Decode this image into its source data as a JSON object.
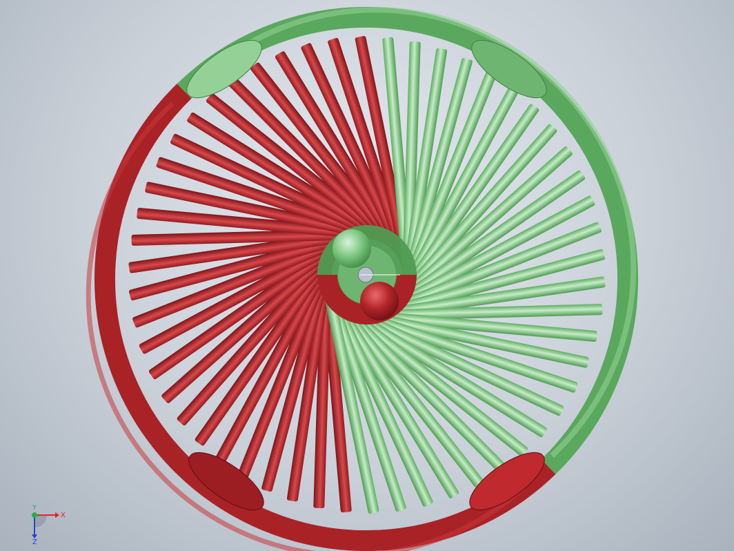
{
  "window": {
    "title": ""
  },
  "model": {
    "description_colors": {
      "green": "#6fbf73",
      "green_light": "#a8dcaa",
      "red": "#b3262a",
      "red_dark": "#8a1a1e"
    },
    "spoke_count_green": 27,
    "spoke_count_red": 27
  },
  "triad": {
    "x_label": "X",
    "y_label": "Y",
    "z_label": "Z",
    "x_color": "#e8202a",
    "y_color": "#22b14c",
    "z_color": "#2a3fd6"
  }
}
